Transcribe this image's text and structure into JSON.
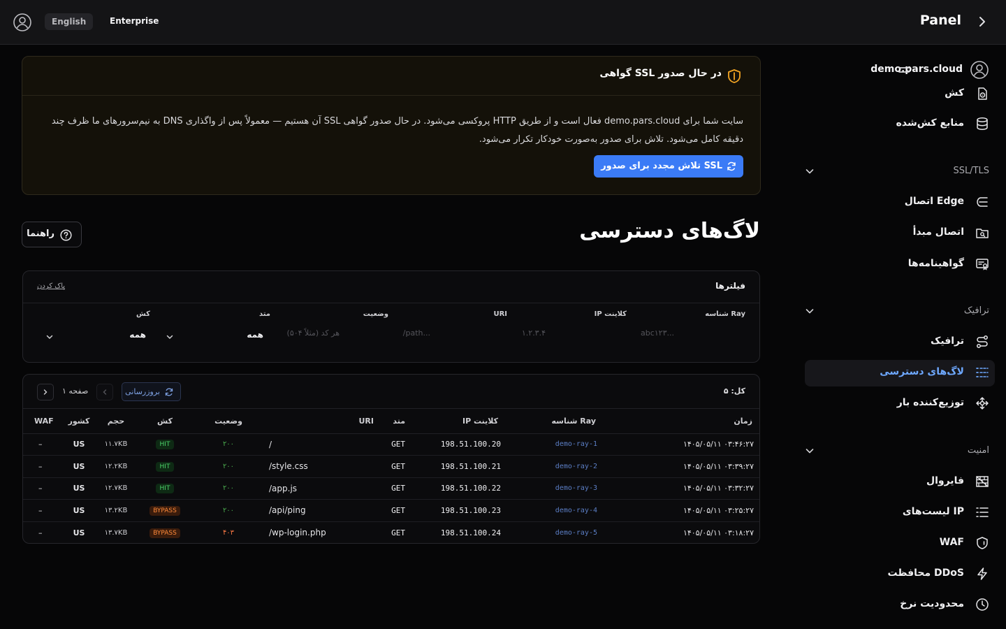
{
  "topbar": {
    "language": "English",
    "plan": "Enterprise",
    "brand": "Panel"
  },
  "sidebar": {
    "site": "demo.pars.cloud",
    "items_top": [
      {
        "label": "کش",
        "icon": "cache-icon"
      },
      {
        "label": "منابع کش‌شده",
        "icon": "database-icon"
      }
    ],
    "sections": [
      {
        "title": "SSL/TLS",
        "items": [
          {
            "label": "اتصال Edge",
            "icon": "edge-connection-icon"
          },
          {
            "label": "اتصال مبدأ",
            "icon": "origin-connection-icon"
          },
          {
            "label": "گواهینامه‌ها",
            "icon": "certificate-icon"
          }
        ]
      },
      {
        "title": "ترافیک",
        "items": [
          {
            "label": "ترافیک",
            "icon": "route-icon"
          },
          {
            "label": "لاگ‌های دسترسی",
            "icon": "list-icon",
            "active": true
          },
          {
            "label": "توزیع‌کننده بار",
            "icon": "load-balancer-icon"
          }
        ]
      },
      {
        "title": "امنیت",
        "items": [
          {
            "label": "فایروال",
            "icon": "firewall-icon"
          },
          {
            "label": "لیست‌های IP",
            "icon": "ip-list-icon"
          },
          {
            "label": "WAF",
            "icon": "shield-icon"
          },
          {
            "label": "محافظت DDoS",
            "icon": "lightning-icon"
          },
          {
            "label": "محدودیت نرخ",
            "icon": "clock-icon"
          }
        ]
      }
    ]
  },
  "ssl_banner": {
    "title": "گواهی SSL در حال صدور",
    "body": "سایت شما برای demo.pars.cloud فعال است و از طریق HTTP پروکسی می‌شود. در حال صدور گواهی SSL آن هستیم — معمولاً پس از واگذاری DNS به نیم‌سرورهای ما ظرف چند دقیقه کامل می‌شود. تلاش برای صدور به‌صورت خودکار تکرار می‌شود.",
    "retry_label": "تلاش مجدد برای صدور SSL",
    "accent": "#f5a623"
  },
  "page": {
    "title": "لاگ‌های دسترسی",
    "help_label": "راهنما"
  },
  "filters": {
    "title": "فیلترها",
    "clear": "پاک کردن",
    "ray_label": "شناسه Ray",
    "ray_placeholder": "abc۱۲۳...",
    "ip_label": "IP کلاینت",
    "ip_placeholder": "۱.۲.۳.۴",
    "uri_label": "URI",
    "uri_placeholder": "/path...",
    "status_label": "وضعیت",
    "status_placeholder": "هر کد (مثلاً ۵۰۴)",
    "method_label": "متد",
    "method_value": "همه",
    "cache_label": "کش",
    "cache_value": "همه"
  },
  "logs": {
    "total": "کل: ۵",
    "refresh": "بروزرسانی",
    "page_label": "صفحه ۱",
    "columns": [
      "زمان",
      "شناسه Ray",
      "IP کلاینت",
      "متد",
      "URI",
      "وضعیت",
      "کش",
      "حجم",
      "کشور",
      "WAF"
    ],
    "rows": [
      {
        "time": "۱۴۰۵/۰۵/۱۱ ۰۳:۴۶:۲۷",
        "ray": "demo-ray-1",
        "ip": "198.51.100.20",
        "method": "GET",
        "uri": "/",
        "status": "۲۰۰",
        "cache": "HIT",
        "size": "۱۱.۷KB",
        "country": "US",
        "waf": "–"
      },
      {
        "time": "۱۴۰۵/۰۵/۱۱ ۰۳:۳۹:۲۷",
        "ray": "demo-ray-2",
        "ip": "198.51.100.21",
        "method": "GET",
        "uri": "/style.css",
        "status": "۲۰۰",
        "cache": "HIT",
        "size": "۱۲.۲KB",
        "country": "US",
        "waf": "–"
      },
      {
        "time": "۱۴۰۵/۰۵/۱۱ ۰۳:۳۲:۲۷",
        "ray": "demo-ray-3",
        "ip": "198.51.100.22",
        "method": "GET",
        "uri": "/app.js",
        "status": "۲۰۰",
        "cache": "HIT",
        "size": "۱۲.۷KB",
        "country": "US",
        "waf": "–"
      },
      {
        "time": "۱۴۰۵/۰۵/۱۱ ۰۳:۲۵:۲۷",
        "ray": "demo-ray-4",
        "ip": "198.51.100.23",
        "method": "GET",
        "uri": "/api/ping",
        "status": "۲۰۰",
        "cache": "BYPASS",
        "size": "۱۳.۲KB",
        "country": "US",
        "waf": "–"
      },
      {
        "time": "۱۴۰۵/۰۵/۱۱ ۰۳:۱۸:۲۷",
        "ray": "demo-ray-5",
        "ip": "198.51.100.24",
        "method": "GET",
        "uri": "/wp-login.php",
        "status": "۴۰۳",
        "cache": "BYPASS",
        "size": "۱۳.۷KB",
        "country": "US",
        "waf": "–"
      }
    ]
  },
  "colors": {
    "background": "#060607",
    "accent_blue": "#3b7bf6",
    "active_link": "#6ea8ff",
    "hit_green": "#4cd36a",
    "bypass_orange": "#ff8a3a"
  }
}
